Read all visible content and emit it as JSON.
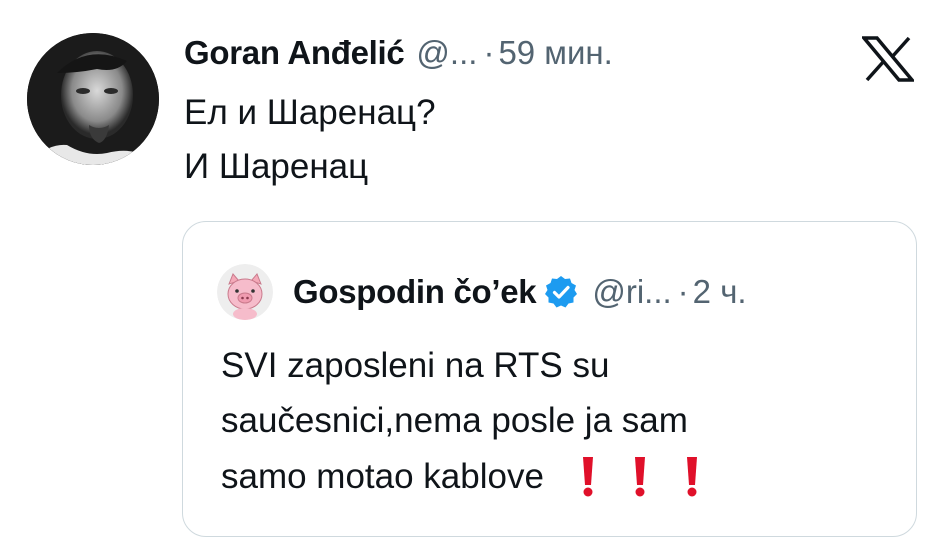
{
  "tweet": {
    "author_name": "Goran Anđelić",
    "handle": "@...",
    "separator": "·",
    "time": "59 мин.",
    "lines": [
      "Ел и Шаренац?",
      "И Шаренац"
    ]
  },
  "quoted_tweet": {
    "author_name": "Gospodin čo’ek",
    "handle": "@ri...",
    "separator": "·",
    "time": "2 ч.",
    "lines": [
      "SVI zaposleni na RTS su",
      "saučesnici,nema posle ja sam",
      "samo motao kablove"
    ],
    "emoji": [
      "red-exclamation-icon",
      "red-exclamation-icon",
      "red-exclamation-icon"
    ]
  },
  "icons": {
    "close": "x-logo-icon",
    "verified": "verified-badge-icon"
  },
  "colors": {
    "text_primary": "#0f1419",
    "text_secondary": "#536471",
    "border": "#cfd9de",
    "verified_blue": "#1d9bf0",
    "emoji_red": "#e0102a"
  }
}
